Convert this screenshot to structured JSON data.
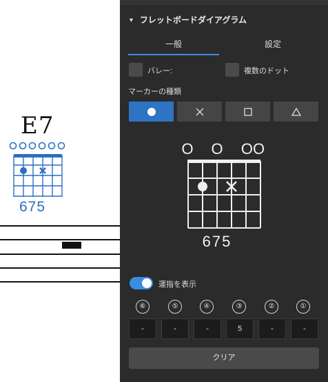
{
  "score": {
    "chord_name": "E7",
    "fingering": "675"
  },
  "panel": {
    "section_title": "フレットボードダイアグラム",
    "tabs": [
      {
        "label": "一般"
      },
      {
        "label": "設定"
      }
    ],
    "barre_label": "バレー:",
    "multi_dot_label": "複数のドット",
    "marker_type_label": "マーカーの種類",
    "marker_buttons": [
      {
        "name": "dot",
        "glyph": "●",
        "active": true
      },
      {
        "name": "cross",
        "glyph": "✕",
        "active": false
      },
      {
        "name": "square",
        "glyph": "□",
        "active": false
      },
      {
        "name": "triangle",
        "glyph": "△",
        "active": false
      }
    ],
    "diagram": {
      "open_markers": [
        "O",
        "O",
        "OO"
      ],
      "fingering": "675"
    },
    "show_fingering_label": "運指を表示",
    "strings": [
      "⑥",
      "⑤",
      "④",
      "③",
      "②",
      "①"
    ],
    "fret_values": [
      "-",
      "-",
      "-",
      "5",
      "-",
      "-"
    ],
    "clear_label": "クリア"
  },
  "colors": {
    "accent": "#2e73c4",
    "score_blue": "#2a6fc2",
    "panel_bg": "#2b2b2b"
  }
}
